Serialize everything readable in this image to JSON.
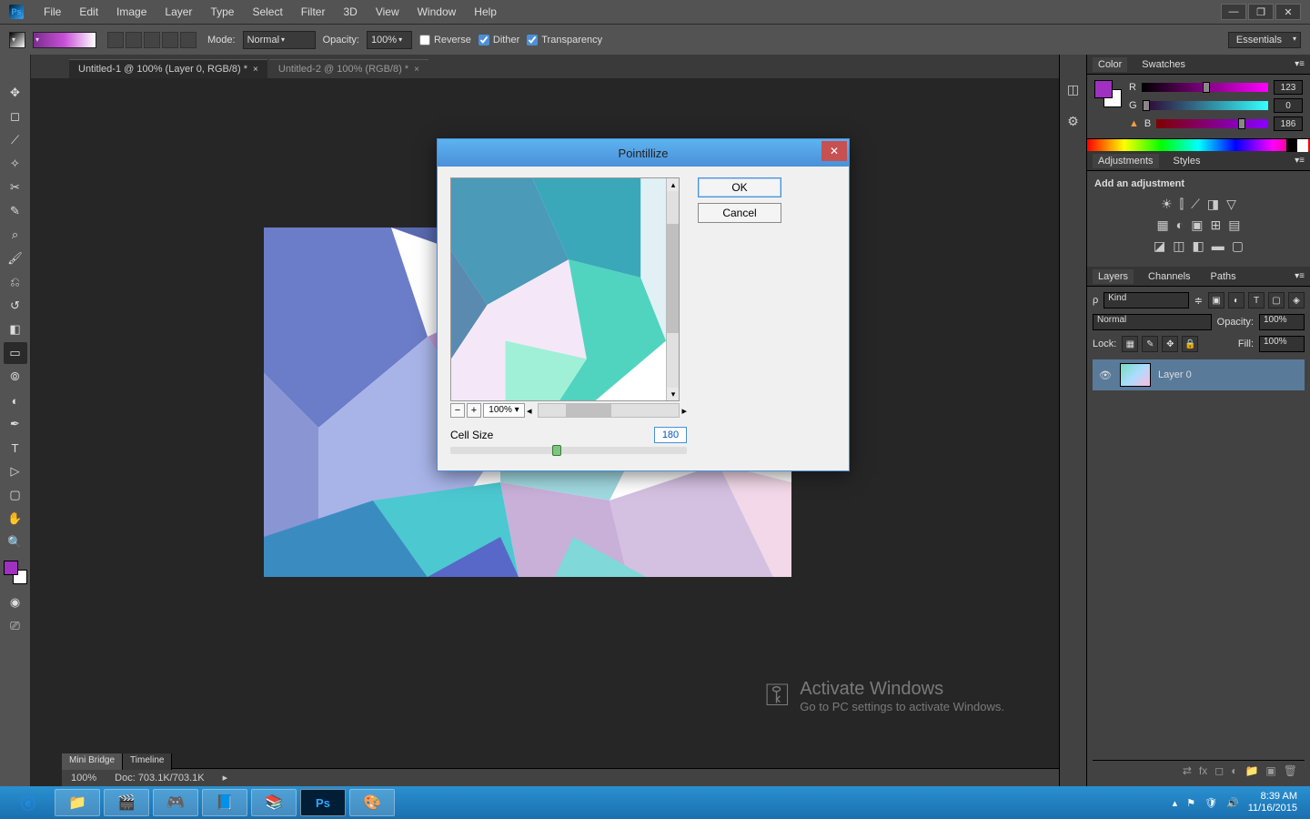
{
  "menubar": {
    "items": [
      "File",
      "Edit",
      "Image",
      "Layer",
      "Type",
      "Select",
      "Filter",
      "3D",
      "View",
      "Window",
      "Help"
    ]
  },
  "optionsbar": {
    "mode_label": "Mode:",
    "mode_value": "Normal",
    "opacity_label": "Opacity:",
    "opacity_value": "100%",
    "reverse": "Reverse",
    "dither": "Dither",
    "transparency": "Transparency",
    "workspace": "Essentials"
  },
  "tabs": [
    {
      "label": "Untitled-1 @ 100% (Layer 0, RGB/8) *",
      "active": true
    },
    {
      "label": "Untitled-2 @ 100% (RGB/8) *",
      "active": false
    }
  ],
  "status": {
    "zoom": "100%",
    "doc": "Doc: 703.1K/703.1K"
  },
  "bottom_tabs": {
    "a": "Mini Bridge",
    "b": "Timeline"
  },
  "panels": {
    "color": {
      "tab1": "Color",
      "tab2": "Swatches",
      "r_label": "R",
      "g_label": "G",
      "b_label": "B",
      "r": "123",
      "g": "0",
      "b": "186"
    },
    "adjustments": {
      "tab1": "Adjustments",
      "tab2": "Styles",
      "hint": "Add an adjustment"
    },
    "layers": {
      "tab1": "Layers",
      "tab2": "Channels",
      "tab3": "Paths",
      "kind": "Kind",
      "blend": "Normal",
      "opacity_label": "Opacity:",
      "opacity": "100%",
      "lock_label": "Lock:",
      "fill_label": "Fill:",
      "fill": "100%",
      "layer0": "Layer 0"
    }
  },
  "dialog": {
    "title": "Pointillize",
    "ok": "OK",
    "cancel": "Cancel",
    "zoom": "100%",
    "cell_label": "Cell Size",
    "cell_value": "180",
    "slider_pos": 0.43
  },
  "watermark": {
    "t1": "Activate Windows",
    "t2": "Go to PC settings to activate Windows."
  },
  "taskbar": {
    "time": "8:39 AM",
    "date": "11/16/2015"
  }
}
